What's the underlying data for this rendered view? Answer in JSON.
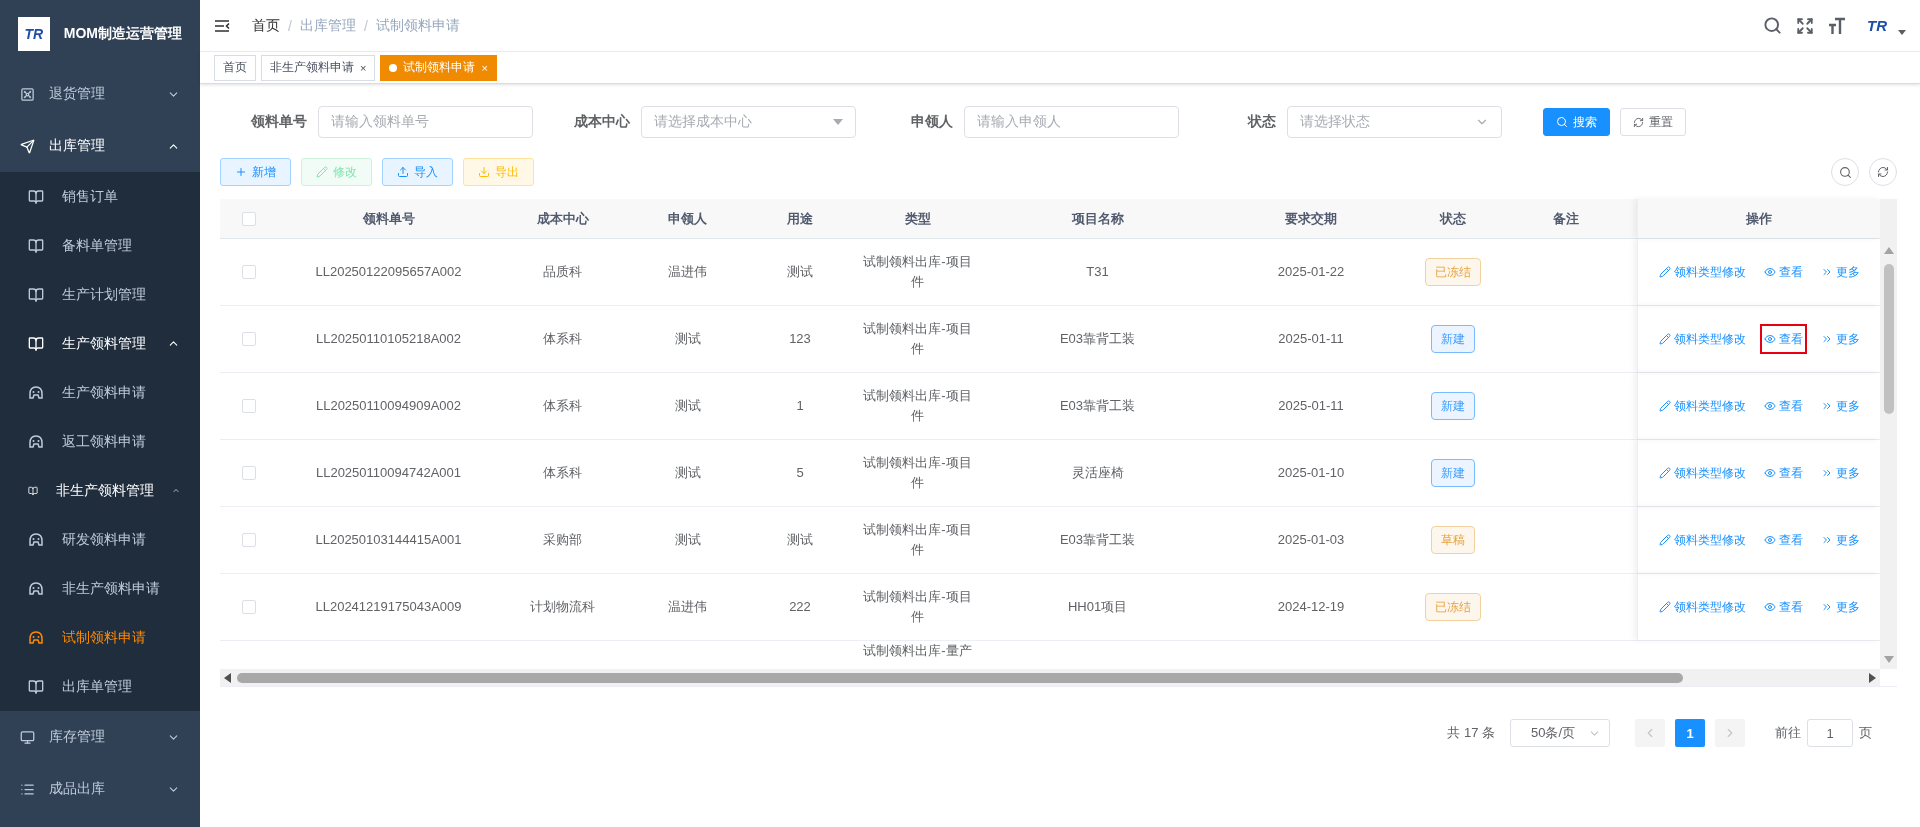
{
  "app": {
    "logo_text": "TR",
    "title": "MOM制造运营管理"
  },
  "sidebar": {
    "items": [
      {
        "label": "退货管理",
        "expanded": false
      },
      {
        "label": "出库管理",
        "expanded": true,
        "children": [
          {
            "label": "销售订单",
            "selected": false
          },
          {
            "label": "备料单管理",
            "selected": false
          },
          {
            "label": "生产计划管理",
            "selected": false
          },
          {
            "label": "生产领料管理",
            "expanded": true,
            "children": [
              {
                "label": "生产领料申请",
                "selected": false
              },
              {
                "label": "返工领料申请",
                "selected": false
              }
            ]
          },
          {
            "label": "非生产领料管理",
            "expanded": true,
            "children": [
              {
                "label": "研发领料申请",
                "selected": false
              },
              {
                "label": "非生产领料申请",
                "selected": false
              },
              {
                "label": "试制领料申请",
                "selected": true
              }
            ]
          },
          {
            "label": "出库单管理",
            "selected": false
          }
        ]
      },
      {
        "label": "库存管理",
        "expanded": false
      },
      {
        "label": "成品出库",
        "expanded": false
      }
    ]
  },
  "header": {
    "breadcrumb": [
      {
        "label": "首页"
      },
      {
        "separator": "/",
        "label": "出库管理"
      },
      {
        "separator": "/",
        "label": "试制领料申请"
      }
    ],
    "avatar_text": "TR"
  },
  "tags": [
    {
      "label": "首页",
      "selected": false
    },
    {
      "label": "非生产领料申请",
      "selected": false,
      "close": "×"
    },
    {
      "label": "试制领料申请",
      "selected": true,
      "close": "×"
    }
  ],
  "filters": [
    {
      "label": "领料单号",
      "placeholder": "请输入领料单号",
      "kind": "input"
    },
    {
      "label": "成本中心",
      "placeholder": "请选择成本中心",
      "kind": "select"
    },
    {
      "label": "申领人",
      "placeholder": "请输入申领人",
      "kind": "input"
    },
    {
      "label": "状态",
      "placeholder": "请选择状态",
      "kind": "select"
    }
  ],
  "filter_buttons": [
    {
      "label": "搜索",
      "kind": "primary"
    },
    {
      "label": "重置",
      "kind": "default"
    }
  ],
  "toolbar": [
    {
      "label": "新增",
      "kind": "add",
      "disabled": false
    },
    {
      "label": "修改",
      "kind": "edit",
      "disabled": true
    },
    {
      "label": "导入",
      "kind": "import",
      "disabled": false
    },
    {
      "label": "导出",
      "kind": "export",
      "disabled": false
    }
  ],
  "table": {
    "header_checked": false,
    "columns": [
      "领料单号",
      "成本中心",
      "申领人",
      "用途",
      "类型",
      "项目名称",
      "要求交期",
      "状态",
      "备注",
      "操作"
    ],
    "rows": [
      {
        "checked": false,
        "id": "LL20250122095657A002",
        "cost_center": "品质科",
        "applicant": "温进伟",
        "purpose": "测试",
        "type": "试制领料出库-项目件",
        "project": "T31",
        "due_date": "2025-01-22",
        "status": {
          "label": "已冻结",
          "kind": "warning"
        },
        "actions": [
          {
            "label": "领料类型修改",
            "kind": "edit",
            "highlighted": false
          },
          {
            "label": "查看",
            "kind": "view",
            "highlighted": false
          },
          {
            "label": "更多",
            "kind": "more",
            "highlighted": false
          }
        ]
      },
      {
        "checked": false,
        "id": "LL20250110105218A002",
        "cost_center": "体系科",
        "applicant": "测试",
        "purpose": "123",
        "type": "试制领料出库-项目件",
        "project": "E03靠背工装",
        "due_date": "2025-01-11",
        "status": {
          "label": "新建",
          "kind": "primary"
        },
        "actions": [
          {
            "label": "领料类型修改",
            "kind": "edit",
            "highlighted": false
          },
          {
            "label": "查看",
            "kind": "view",
            "highlighted": true
          },
          {
            "label": "更多",
            "kind": "more",
            "highlighted": false
          }
        ]
      },
      {
        "checked": false,
        "id": "LL20250110094909A002",
        "cost_center": "体系科",
        "applicant": "测试",
        "purpose": "1",
        "type": "试制领料出库-项目件",
        "project": "E03靠背工装",
        "due_date": "2025-01-11",
        "status": {
          "label": "新建",
          "kind": "primary"
        },
        "actions": [
          {
            "label": "领料类型修改",
            "kind": "edit",
            "highlighted": false
          },
          {
            "label": "查看",
            "kind": "view",
            "highlighted": false
          },
          {
            "label": "更多",
            "kind": "more",
            "highlighted": false
          }
        ]
      },
      {
        "checked": false,
        "id": "LL20250110094742A001",
        "cost_center": "体系科",
        "applicant": "测试",
        "purpose": "5",
        "type": "试制领料出库-项目件",
        "project": "灵活座椅",
        "due_date": "2025-01-10",
        "status": {
          "label": "新建",
          "kind": "primary"
        },
        "actions": [
          {
            "label": "领料类型修改",
            "kind": "edit",
            "highlighted": false
          },
          {
            "label": "查看",
            "kind": "view",
            "highlighted": false
          },
          {
            "label": "更多",
            "kind": "more",
            "highlighted": false
          }
        ]
      },
      {
        "checked": false,
        "id": "LL20250103144415A001",
        "cost_center": "采购部",
        "applicant": "测试",
        "purpose": "测试",
        "type": "试制领料出库-项目件",
        "project": "E03靠背工装",
        "due_date": "2025-01-03",
        "status": {
          "label": "草稿",
          "kind": "warning"
        },
        "actions": [
          {
            "label": "领料类型修改",
            "kind": "edit",
            "highlighted": false
          },
          {
            "label": "查看",
            "kind": "view",
            "highlighted": false
          },
          {
            "label": "更多",
            "kind": "more",
            "highlighted": false
          }
        ]
      },
      {
        "checked": false,
        "id": "LL20241219175043A009",
        "cost_center": "计划物流科",
        "applicant": "温进伟",
        "purpose": "222",
        "type": "试制领料出库-项目件",
        "project": "HH01项目",
        "due_date": "2024-12-19",
        "status": {
          "label": "已冻结",
          "kind": "warning"
        },
        "actions": [
          {
            "label": "领料类型修改",
            "kind": "edit",
            "highlighted": false
          },
          {
            "label": "查看",
            "kind": "view",
            "highlighted": false
          },
          {
            "label": "更多",
            "kind": "more",
            "highlighted": false
          }
        ]
      },
      {
        "type": "试制领料出库-量产"
      }
    ]
  },
  "pagination": {
    "total": "共 17 条",
    "page_size": "50条/页",
    "pages": [
      {
        "label": "1",
        "selected": true
      }
    ],
    "goto_label": "前往",
    "goto_value": "1",
    "page_suffix": "页"
  }
}
